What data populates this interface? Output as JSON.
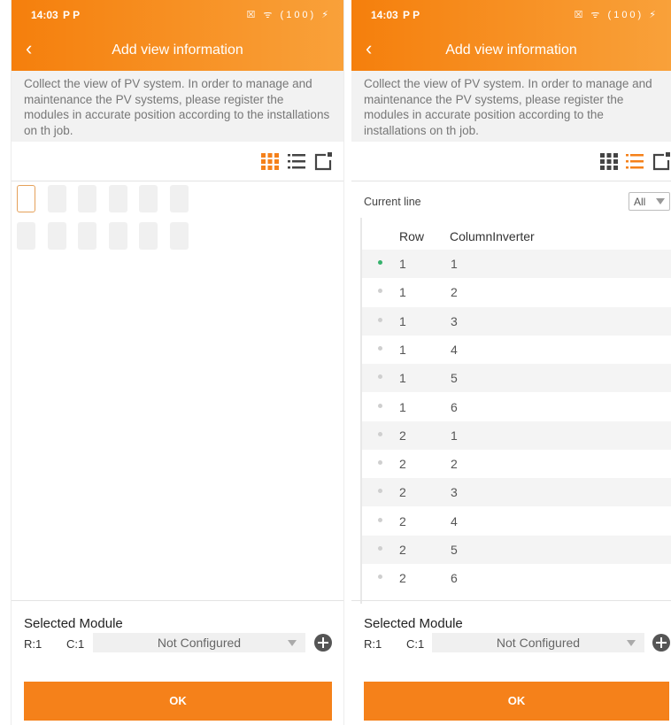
{
  "status": {
    "time": "14:03",
    "notif_icons": "P P",
    "battery": "100",
    "right_icons": "☒ ᯤ (100) ⚡"
  },
  "header": {
    "title": "Add view information",
    "back_icon": "chevron-left-icon"
  },
  "description": "Collect the view of PV system. In order to manage and maintenance the PV systems, please register the modules in accurate position according to the installations on th job.",
  "view_modes": [
    "grid-view-icon",
    "list-view-icon",
    "edit-view-icon"
  ],
  "colors": {
    "accent": "#f5811a",
    "active_dot": "#36b26c"
  },
  "left_screen": {
    "active_view": "grid",
    "grid": {
      "rows": 2,
      "cols": 6,
      "selected": [
        1,
        1
      ]
    }
  },
  "right_screen": {
    "active_view": "list",
    "current_line_label": "Current line",
    "current_line_value": "All",
    "table": {
      "headers": {
        "row": "Row",
        "column_inverter": "ColumnInverter"
      },
      "rows": [
        {
          "row": "1",
          "col": "1",
          "active": true
        },
        {
          "row": "1",
          "col": "2",
          "active": false
        },
        {
          "row": "1",
          "col": "3",
          "active": false
        },
        {
          "row": "1",
          "col": "4",
          "active": false
        },
        {
          "row": "1",
          "col": "5",
          "active": false
        },
        {
          "row": "1",
          "col": "6",
          "active": false
        },
        {
          "row": "2",
          "col": "1",
          "active": false
        },
        {
          "row": "2",
          "col": "2",
          "active": false
        },
        {
          "row": "2",
          "col": "3",
          "active": false
        },
        {
          "row": "2",
          "col": "4",
          "active": false
        },
        {
          "row": "2",
          "col": "5",
          "active": false
        },
        {
          "row": "2",
          "col": "6",
          "active": false
        }
      ]
    }
  },
  "selected_module": {
    "label": "Selected Module",
    "r": "R:1",
    "c": "C:1",
    "value": "Not Configured"
  },
  "ok_label": "OK"
}
